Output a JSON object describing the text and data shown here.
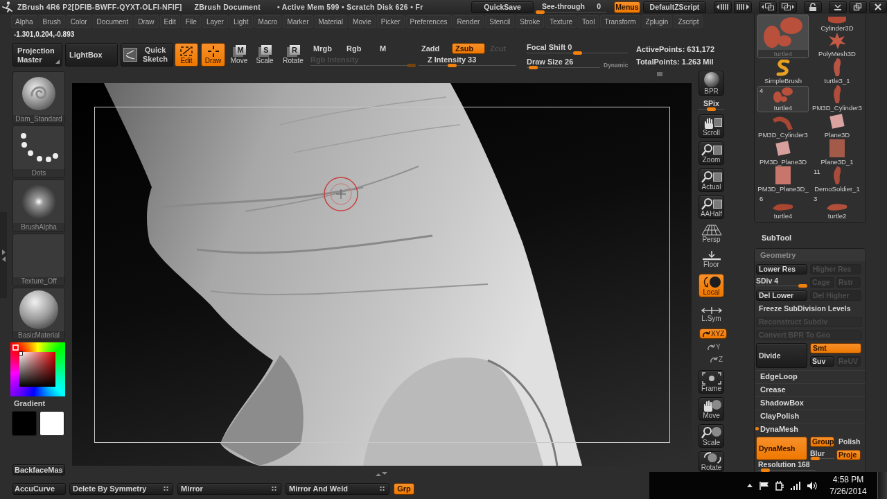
{
  "title_bar": {
    "title": "ZBrush 4R6 P2[DFIB-BWFF-QYXT-OLFI-NFIF]",
    "document": "ZBrush Document",
    "status": "• Active Mem 599 • Scratch Disk 626 • Fr",
    "quicksave": "QuickSave",
    "see_through": {
      "label": "See-through",
      "value": "0",
      "level": 0
    },
    "menus": {
      "label": "Menus",
      "on": true
    },
    "script": "DefaultZScript"
  },
  "menu": [
    "Alpha",
    "Brush",
    "Color",
    "Document",
    "Draw",
    "Edit",
    "File",
    "Layer",
    "Light",
    "Macro",
    "Marker",
    "Material",
    "Movie",
    "Picker",
    "Preferences",
    "Render",
    "Stencil",
    "Stroke",
    "Texture",
    "Tool",
    "Transform",
    "Zplugin",
    "Zscript"
  ],
  "coordinates": "-1.301,0.204,-0.893",
  "toolbar": {
    "projection_master": "Projection Master",
    "lightbox": "LightBox",
    "quick_sketch": "Quick Sketch",
    "modes": [
      {
        "label": "Edit",
        "selected": true
      },
      {
        "label": "Draw",
        "selected": true
      },
      {
        "label": "Move",
        "glyph": "M",
        "selected": false
      },
      {
        "label": "Scale",
        "glyph": "S",
        "selected": false
      },
      {
        "label": "Rotate",
        "glyph": "R",
        "selected": false
      }
    ],
    "color_modes": [
      {
        "label": "Mrgb",
        "on": false
      },
      {
        "label": "Rgb",
        "on": false
      },
      {
        "label": "M",
        "on": false
      }
    ],
    "rgb_intensity": {
      "label": "Rgb Intensity",
      "disabled": true,
      "level": 1
    },
    "z_modes": [
      {
        "label": "Zadd",
        "on": false,
        "disabled": false
      },
      {
        "label": "Zsub",
        "on": true,
        "disabled": false
      },
      {
        "label": "Zcut",
        "on": false,
        "disabled": true
      }
    ],
    "z_intensity": {
      "label": "Z Intensity 33",
      "level": 0.33
    },
    "focal_shift": {
      "label": "Focal Shift 0",
      "level": 0.5
    },
    "draw_size": {
      "label": "Draw Size 26",
      "level": 0.03
    },
    "dynamic": {
      "label": "Dynamic",
      "on": false
    },
    "active_points": "ActivePoints: 631,172",
    "total_points": "TotalPoints: 1.263 Mil"
  },
  "left_shelf": {
    "items": [
      {
        "label": "Dam_Standard",
        "kind": "brush"
      },
      {
        "label": "Dots",
        "kind": "stroke"
      },
      {
        "label": "BrushAlpha",
        "kind": "alpha"
      },
      {
        "label": "Texture_Off",
        "kind": "texture"
      },
      {
        "label": "BasicMaterial",
        "kind": "material"
      }
    ],
    "gradient": "Gradient",
    "swatches": [
      {
        "color": "#000000"
      },
      {
        "color": "#ffffff"
      }
    ],
    "backface": "BackfaceMas",
    "accucurve": "AccuCurve"
  },
  "right_shelf": [
    {
      "label": "BPR",
      "kind": "render",
      "on": false
    },
    {
      "label": "SPix",
      "kind": "slider",
      "level": 0.5
    },
    {
      "label": "Scroll",
      "kind": "hand",
      "on": false
    },
    {
      "label": "Zoom",
      "kind": "zoom",
      "on": false
    },
    {
      "label": "Actual",
      "kind": "zoom",
      "on": false
    },
    {
      "label": "AAHalf",
      "kind": "zoom",
      "on": false
    },
    {
      "label": "Persp",
      "kind": "grid",
      "on": false
    },
    {
      "label": "Floor",
      "kind": "floor",
      "on": false
    },
    {
      "label": "Local",
      "kind": "local",
      "on": true
    },
    {
      "label": "L.Sym",
      "kind": "symmetry",
      "on": false
    },
    {
      "label": "XYZ",
      "kind": "axis",
      "on": true
    },
    {
      "label": "Y",
      "kind": "axis",
      "on": false
    },
    {
      "label": "Z",
      "kind": "axis",
      "on": false
    },
    {
      "label": "Frame",
      "kind": "frame",
      "on": false
    },
    {
      "label": "Move",
      "kind": "move",
      "on": false
    },
    {
      "label": "Scale",
      "kind": "scale",
      "on": false
    },
    {
      "label": "Rotate",
      "kind": "rotate",
      "on": false
    }
  ],
  "tool_palette": {
    "items": [
      {
        "label": "turtle4",
        "kind": "large",
        "selected": true
      },
      {
        "label": "Cylinder3D",
        "kind": "small",
        "selected": false
      },
      {
        "label": "PolyMesh3D",
        "kind": "small",
        "selected": false
      },
      {
        "label": "SimpleBrush",
        "kind": "small",
        "selected": false
      },
      {
        "label": "turtle3_1",
        "kind": "small",
        "selected": false
      },
      {
        "label": "turtle4",
        "kind": "small",
        "count": "4",
        "selected": true
      },
      {
        "label": "PM3D_Cylinder3",
        "kind": "small",
        "selected": false
      },
      {
        "label": "PM3D_Cylinder3",
        "kind": "small",
        "selected": false
      },
      {
        "label": "Plane3D",
        "kind": "small",
        "selected": false
      },
      {
        "label": "PM3D_Plane3D",
        "kind": "small",
        "selected": false
      },
      {
        "label": "Plane3D_1",
        "kind": "small",
        "selected": false
      },
      {
        "label": "PM3D_Plane3D_",
        "kind": "small",
        "selected": false
      },
      {
        "label": "DemoSoldier_1",
        "kind": "small",
        "count": "11",
        "selected": false
      },
      {
        "label": "turtle4",
        "kind": "small",
        "count": "6",
        "selected": false
      },
      {
        "label": "turtle2",
        "kind": "small",
        "count": "3",
        "selected": false
      }
    ]
  },
  "subtool": "SubTool",
  "geometry": {
    "title": "Geometry",
    "res_buttons": [
      {
        "label": "Lower Res",
        "disabled": false
      },
      {
        "label": "Higher Res",
        "disabled": true
      }
    ],
    "sdiv": {
      "label": "SDiv 4",
      "level": 1
    },
    "cage_buttons": [
      {
        "label": "Cage",
        "disabled": true
      },
      {
        "label": "Rstr",
        "disabled": true
      }
    ],
    "del_buttons": [
      {
        "label": "Del Lower",
        "disabled": false
      },
      {
        "label": "Del Higher",
        "disabled": true
      }
    ],
    "wide_buttons": [
      {
        "label": "Freeze SubDivision Levels",
        "disabled": false
      },
      {
        "label": "Reconstruct Subdiv",
        "disabled": true
      },
      {
        "label": "Convert BPR To Geo",
        "disabled": true
      }
    ],
    "divide": {
      "label": "Divide"
    },
    "divide_options": [
      {
        "label": "Smt",
        "on": true,
        "disabled": false
      },
      {
        "label": "Suv",
        "on": false,
        "disabled": false
      },
      {
        "label": "ReUV",
        "on": false,
        "disabled": true
      }
    ],
    "sections": [
      {
        "label": "EdgeLoop",
        "expanded": false
      },
      {
        "label": "Crease",
        "expanded": false
      },
      {
        "label": "ShadowBox",
        "expanded": false
      },
      {
        "label": "ClayPolish",
        "expanded": false
      },
      {
        "label": "DynaMesh",
        "expanded": true
      }
    ],
    "dynamesh": {
      "button": {
        "label": "DynaMesh",
        "on": true
      },
      "group": {
        "label": "Group",
        "on": true
      },
      "polish": {
        "label": "Polish",
        "on": false
      },
      "blur": {
        "label": "Blur",
        "level": 0.05
      },
      "project": {
        "label": "Proje",
        "on": true
      },
      "resolution": {
        "label": "Resolution 168",
        "level": 0.05
      }
    }
  },
  "bottom_bar": [
    {
      "label": "Delete By Symmetry",
      "kind": "options",
      "on": false
    },
    {
      "label": "Mirror",
      "kind": "options",
      "on": false
    },
    {
      "label": "Mirror And Weld",
      "kind": "options",
      "on": false
    },
    {
      "label": "Grp",
      "kind": "toggle",
      "on": true
    }
  ],
  "taskbar": {
    "time": "4:58 PM",
    "date": "7/26/2014"
  }
}
